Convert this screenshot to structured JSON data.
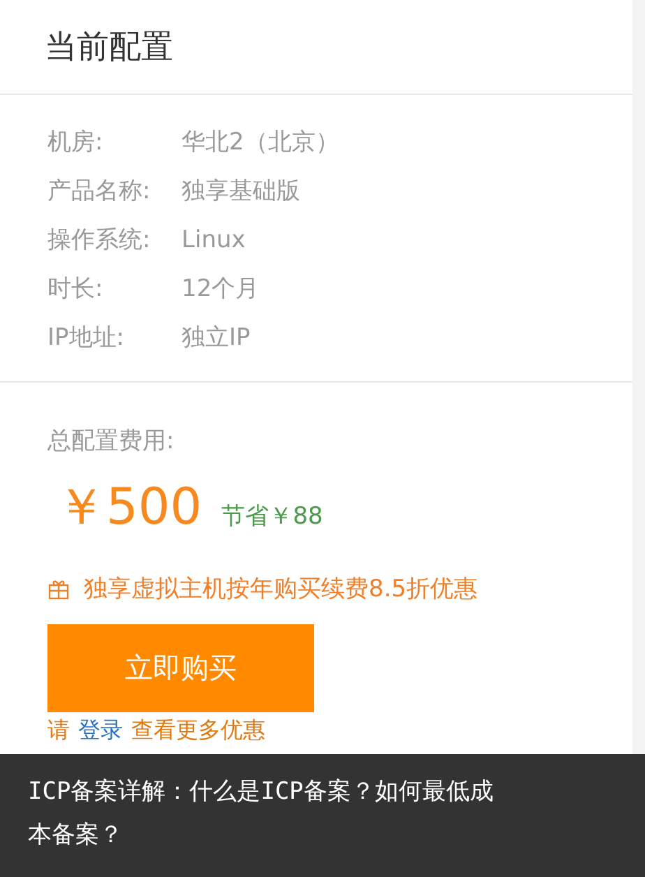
{
  "card": {
    "title": "当前配置",
    "specs": [
      {
        "label": "机房:",
        "value": "华北2（北京）"
      },
      {
        "label": "产品名称:",
        "value": "独享基础版"
      },
      {
        "label": "操作系统:",
        "value": "Linux"
      },
      {
        "label": "时长:",
        "value": "12个月"
      },
      {
        "label": "IP地址:",
        "value": "独立IP"
      }
    ],
    "total_label": "总配置费用:",
    "price": "￥500",
    "saving": "节省￥88",
    "promo": "独享虚拟主机按年购买续费8.5折优惠",
    "buy_button": "立即购买",
    "login_hint": {
      "before": "请",
      "link": "登录",
      "after": "查看更多优惠"
    }
  },
  "caption": {
    "text": "ICP备案详解：什么是ICP备案？如何最低成本备案？"
  }
}
